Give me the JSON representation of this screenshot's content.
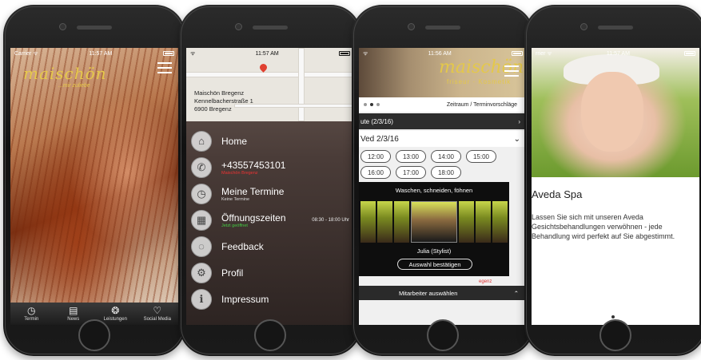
{
  "phone1": {
    "status": {
      "carrier": "Carrier ᯤ",
      "time": "11:57 AM"
    },
    "logo": "maischön",
    "tagline": "...mir zuliebe",
    "tabs": [
      {
        "label": "Termin",
        "icon": "clock-icon"
      },
      {
        "label": "News",
        "icon": "newspaper-icon"
      },
      {
        "label": "Leistungen",
        "icon": "aperture-icon"
      },
      {
        "label": "Social Media",
        "icon": "heart-icon"
      }
    ]
  },
  "phone2": {
    "status": {
      "time": "11:57 AM"
    },
    "address": {
      "line1": "Maischön Bregenz",
      "line2": "Kennelbacherstraße 1",
      "line3": "6900 Bregenz"
    },
    "menu": [
      {
        "label": "Home",
        "sub": "",
        "icon": "home-icon"
      },
      {
        "label": "+43557453101",
        "sub": "Maischön Bregenz",
        "icon": "phone-icon"
      },
      {
        "label": "Meine Termine",
        "sub": "Keine Termine",
        "icon": "clock-icon"
      },
      {
        "label": "Öffnungszeiten",
        "sub": "Jetzt geöffnet",
        "hours": "08:30 - 18:00 Uhr",
        "icon": "calendar-icon"
      },
      {
        "label": "Feedback",
        "sub": "",
        "icon": "chat-bubble-icon"
      },
      {
        "label": "Profil",
        "sub": "",
        "icon": "gear-icon"
      },
      {
        "label": "Impressum",
        "sub": "",
        "icon": "info-icon"
      }
    ]
  },
  "phone3": {
    "status": {
      "time": "11:56 AM"
    },
    "logo": "maischön",
    "logo_sub": "friseur · Kosmetik",
    "header_right": "Zeitraum / Terminvorschläge",
    "date_row": "ute (2/3/16)",
    "date_header": "Ved 2/3/16",
    "slots": [
      "12:00",
      "13:00",
      "14:00",
      "15:00",
      "16:00",
      "17:00",
      "18:00"
    ],
    "popup": {
      "title": "Waschen, schneiden, föhnen",
      "stylist": "Julia (Stylist)",
      "confirm": "Auswahl bestätigen"
    },
    "red_text": "egenz",
    "bottom_label": "Mitarbeiter auswählen"
  },
  "phone4": {
    "status": {
      "carrier": "rrier ᯤ",
      "time": "11:57 AM"
    },
    "title": "Aveda Spa",
    "body": "Lassen Sie sich mit unseren Aveda Gesichtsbehandlungen verwöhnen - jede Behandlung wird perfekt auf Sie abgestimmt."
  }
}
